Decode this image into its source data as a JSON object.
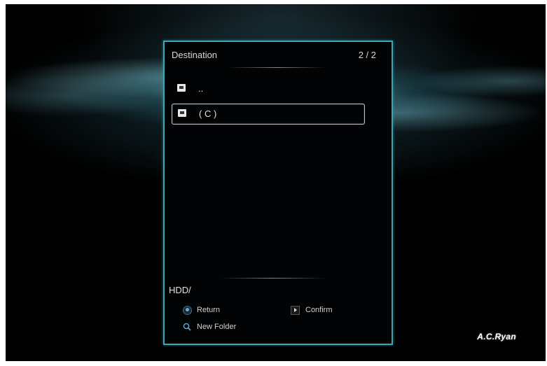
{
  "dialog": {
    "title": "Destination",
    "page_indicator": "2 / 2",
    "items": [
      {
        "label": ".."
      },
      {
        "label": "( C )"
      }
    ],
    "path": "HDD/",
    "hints": {
      "return_label": "Return",
      "confirm_label": "Confirm",
      "new_folder_label": "New Folder"
    }
  },
  "brand": {
    "logo_text": "A.C.Ryan"
  },
  "colors": {
    "dialog_border": "#3aa7b2",
    "selection_border": "#bfc8cc",
    "return_button": "#5fb0e0"
  },
  "icons": [
    "folder-up-icon",
    "drive-icon",
    "return-button-icon",
    "confirm-arrow-icon",
    "new-folder-search-icon"
  ]
}
